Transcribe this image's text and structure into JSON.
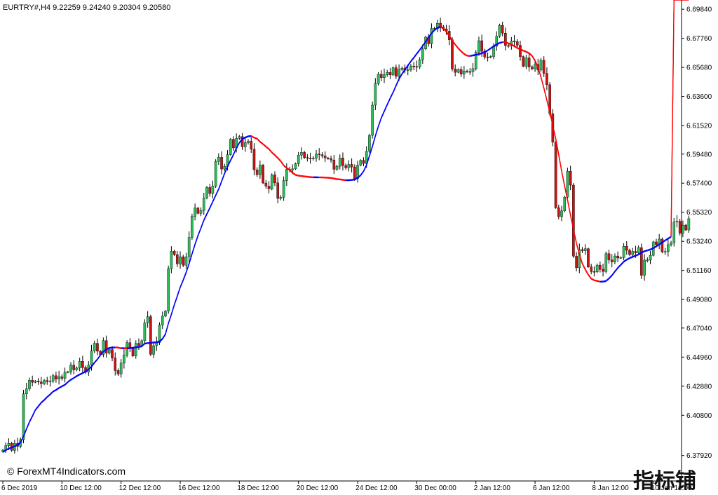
{
  "header": {
    "text": "EURTRY#,H4  9.22259 9.24240 9.20304 9.20580"
  },
  "watermark": {
    "text": "© ForexMT4Indicators.com"
  },
  "stamp": {
    "text": "指标铺"
  },
  "chart_data": {
    "type": "candlestick",
    "ylim": [
      6.361,
      6.705
    ],
    "y_ticks": [
      6.3792,
      6.408,
      6.4288,
      6.4496,
      6.4704,
      6.4908,
      6.5116,
      6.5324,
      6.5532,
      6.574,
      6.5948,
      6.6152,
      6.636,
      6.6568,
      6.6776,
      6.6984
    ],
    "x_ticks": [
      {
        "label": "6 Dec 2019",
        "index": 0
      },
      {
        "label": "10 Dec 12:00",
        "index": 20
      },
      {
        "label": "12 Dec 12:00",
        "index": 40
      },
      {
        "label": "16 Dec 12:00",
        "index": 60
      },
      {
        "label": "18 Dec 12:00",
        "index": 80
      },
      {
        "label": "20 Dec 12:00",
        "index": 100
      },
      {
        "label": "24 Dec 12:00",
        "index": 120
      },
      {
        "label": "30 Dec 00:00",
        "index": 140
      },
      {
        "label": "2 Jan 12:00",
        "index": 160
      },
      {
        "label": "6 Jan 12:00",
        "index": 180
      },
      {
        "label": "8 Jan 12:00",
        "index": 200
      },
      {
        "label": "10 Jan 12:00",
        "index": 220
      }
    ],
    "series": {
      "close": [
        6.3831,
        6.3863,
        6.3879,
        6.3829,
        6.3879,
        6.3858,
        6.3906,
        6.4233,
        6.4269,
        6.4331,
        6.4316,
        6.4324,
        6.4318,
        6.4306,
        6.4329,
        6.4321,
        6.4324,
        6.4363,
        6.4339,
        6.4355,
        6.4344,
        6.4388,
        6.439,
        6.4438,
        6.4405,
        6.4418,
        6.4466,
        6.4421,
        6.4388,
        6.4438,
        6.4541,
        6.4595,
        6.4538,
        6.4515,
        6.4614,
        6.4525,
        6.455,
        6.449,
        6.44,
        6.4375,
        6.4453,
        6.4511,
        6.4599,
        6.4562,
        6.4504,
        6.4594,
        6.458,
        6.4613,
        6.4741,
        6.4785,
        6.4516,
        6.4578,
        6.46,
        6.4726,
        6.4789,
        6.4825,
        6.5128,
        6.5253,
        6.5229,
        6.5163,
        6.5213,
        6.5153,
        6.5213,
        6.5352,
        6.5503,
        6.5562,
        6.5524,
        6.5545,
        6.5635,
        6.5709,
        6.5666,
        6.5719,
        6.5896,
        6.5925,
        6.5841,
        6.586,
        6.5944,
        6.6054,
        6.5992,
        6.606,
        6.6073,
        6.6,
        6.603,
        6.604,
        6.5983,
        6.5835,
        6.5801,
        6.5869,
        6.5741,
        6.5719,
        6.5699,
        6.5799,
        6.5742,
        6.5631,
        6.5639,
        6.5759,
        6.5839,
        6.5834,
        6.5842,
        6.5879,
        6.5941,
        6.596,
        6.5923,
        6.5918,
        6.5915,
        6.5919,
        6.5948,
        6.5943,
        6.5935,
        6.592,
        6.5915,
        6.5906,
        6.5839,
        6.5861,
        6.592,
        6.5866,
        6.585,
        6.5874,
        6.5856,
        6.5773,
        6.5868,
        6.5903,
        6.5881,
        6.5968,
        6.6082,
        6.6298,
        6.6452,
        6.6519,
        6.6495,
        6.6516,
        6.6532,
        6.6514,
        6.6566,
        6.6504,
        6.6553,
        6.6563,
        6.6548,
        6.655,
        6.6578,
        6.6574,
        6.6573,
        6.6623,
        6.67,
        6.6785,
        6.6737,
        6.6847,
        6.6843,
        6.6884,
        6.6856,
        6.6843,
        6.6827,
        6.6766,
        6.6557,
        6.6533,
        6.6553,
        6.652,
        6.6542,
        6.6538,
        6.6537,
        6.6559,
        6.6678,
        6.6759,
        6.6683,
        6.6642,
        6.664,
        6.6646,
        6.6719,
        6.679,
        6.6869,
        6.6813,
        6.6724,
        6.6721,
        6.6756,
        6.6752,
        6.6726,
        6.6645,
        6.6576,
        6.6636,
        6.6571,
        6.6558,
        6.659,
        6.6549,
        6.6619,
        6.6525,
        6.6444,
        6.6237,
        6.6033,
        6.5564,
        6.5501,
        6.5542,
        6.564,
        6.5825,
        6.5726,
        6.5218,
        6.5135,
        6.5265,
        6.5257,
        6.5271,
        6.5141,
        6.5108,
        6.5106,
        6.5154,
        6.5124,
        6.5108,
        6.5236,
        6.519,
        6.5177,
        6.5219,
        6.5205,
        6.5208,
        6.5289,
        6.526,
        6.5229,
        6.5252,
        6.5242,
        6.5279,
        6.5081,
        6.519,
        6.519,
        6.5224,
        6.532,
        6.5301,
        6.534,
        6.5249,
        6.5251,
        6.53,
        6.5313,
        6.5462,
        6.5467,
        6.5383,
        6.544,
        6.5405,
        6.5486
      ],
      "ma_lower": [
        6.3813,
        6.3828,
        6.3839,
        6.3847,
        6.3856,
        6.3866,
        6.3883,
        6.3926,
        6.3979,
        6.4028,
        6.407,
        6.4115,
        6.4141,
        6.4167,
        6.4186,
        6.4208,
        6.4226,
        6.4247,
        6.4258,
        6.4272,
        6.4284,
        6.4295,
        6.4315,
        6.4331,
        6.4344,
        6.4357,
        6.4369,
        6.4378,
        6.4391,
        6.4405,
        6.4424,
        6.4454,
        6.4478,
        6.4507,
        6.4533,
        6.4548,
        6.4559,
        6.456,
        6.4562,
        6.4561,
        6.4556,
        6.4557,
        6.4556,
        6.4557,
        6.4559,
        6.4563,
        6.4566,
        6.457,
        6.459,
        6.4593,
        6.4594,
        6.4598,
        6.4598,
        6.4605,
        6.4623,
        6.4657,
        6.4734,
        6.4798,
        6.4867,
        6.4928,
        6.4993,
        6.5043,
        6.5098,
        6.5161,
        6.5231,
        6.5299,
        6.5361,
        6.5416,
        6.5472,
        6.5516,
        6.5559,
        6.5605,
        6.5649,
        6.5695,
        6.575,
        6.5806,
        6.5856,
        6.5899,
        6.5941,
        6.5988,
        6.6026,
        6.6053,
        6.6064,
        6.6072,
        6.6075,
        6.6063,
        6.6056,
        6.6033,
        6.6017,
        6.5998,
        6.5981,
        6.5957,
        6.5938,
        6.5917,
        6.5894,
        6.5864,
        6.5846,
        6.5832,
        6.5811,
        6.5796,
        6.5791,
        6.5788,
        6.5785,
        6.5783,
        6.578,
        6.5779,
        6.5779,
        6.5779,
        6.5778,
        6.5777,
        6.5776,
        6.5774,
        6.577,
        6.5766,
        6.5764,
        6.5761,
        6.5758,
        6.5758,
        6.576,
        6.5763,
        6.5775,
        6.5793,
        6.5822,
        6.5867,
        6.5932,
        6.6,
        6.6075,
        6.6142,
        6.6204,
        6.6251,
        6.6298,
        6.6344,
        6.6387,
        6.6435,
        6.6482,
        6.6518,
        6.6549,
        6.6578,
        6.6608,
        6.6634,
        6.6663,
        6.669,
        6.6719,
        6.6749,
        6.6781,
        6.6809,
        6.6832,
        6.6848,
        6.6855,
        6.6844,
        6.6821,
        6.6789,
        6.6757,
        6.6729,
        6.6702,
        6.668,
        6.6661,
        6.6649,
        6.6647,
        6.6651,
        6.6655,
        6.666,
        6.6666,
        6.6675,
        6.6687,
        6.6701,
        6.6716,
        6.6729,
        6.674,
        6.6746,
        6.6745,
        6.6737,
        6.6729,
        6.6717,
        6.6704,
        6.6695,
        6.6685,
        6.6677,
        6.6666,
        6.6647,
        6.6614,
        6.6565,
        6.6496,
        6.6417,
        6.633,
        6.6247,
        6.615,
        6.6055,
        6.5942,
        6.5823,
        6.5717,
        6.5616,
        6.5508,
        6.5405,
        6.5308,
        6.5228,
        6.5162,
        6.5119,
        6.5083,
        6.5054,
        6.5043,
        6.5038,
        6.5033,
        6.5033,
        6.5037,
        6.5055,
        6.5077,
        6.5105,
        6.5131,
        6.5153,
        6.5175,
        6.519,
        6.5201,
        6.521,
        6.5218,
        6.5227,
        6.524,
        6.525,
        6.5256,
        6.5263,
        6.5272,
        6.5285,
        6.5299,
        6.5313,
        6.5327,
        6.5341,
        6.5353
      ],
      "ma_upper": [
        6.3819,
        6.3833,
        6.3844,
        6.3852,
        6.3861,
        6.3872,
        6.3889,
        6.3931,
        6.3985,
        6.4034,
        6.4076,
        6.412,
        6.4147,
        6.4173,
        6.4192,
        6.4213,
        6.4232,
        6.4252,
        6.4264,
        6.4278,
        6.429,
        6.4301,
        6.432,
        6.4337,
        6.4349,
        6.4363,
        6.4375,
        6.4384,
        6.4396,
        6.4411,
        6.443,
        6.4459,
        6.4483,
        6.4512,
        6.4538,
        6.4554,
        6.4565,
        6.4566,
        6.4568,
        6.4567,
        6.4562,
        6.4563,
        6.4562,
        6.4563,
        6.4565,
        6.4569,
        6.4572,
        6.4576,
        6.4596,
        6.4599,
        6.4599,
        6.4604,
        6.4604,
        6.4611,
        6.4629,
        6.4663,
        6.4739,
        6.4804,
        6.4873,
        6.4934,
        6.4998,
        6.5049,
        6.5104,
        6.5167,
        6.5237,
        6.5305,
        6.5367,
        6.5421,
        6.5478,
        6.5522,
        6.5565,
        6.561,
        6.5655,
        6.57,
        6.5756,
        6.5812,
        6.5862,
        6.5905,
        6.5947,
        6.5994,
        6.6032,
        6.6058,
        6.607,
        6.6078,
        6.608,
        6.6068,
        6.6061,
        6.6039,
        6.6022,
        6.6004,
        6.5987,
        6.5962,
        6.5944,
        6.5923,
        6.59,
        6.587,
        6.5851,
        6.5838,
        6.5817,
        6.5802,
        6.5797,
        6.5794,
        6.5791,
        6.5789,
        6.5786,
        6.5785,
        6.5785,
        6.5784,
        6.5784,
        6.5783,
        6.5782,
        6.578,
        6.5776,
        6.5771,
        6.577,
        6.5767,
        6.5764,
        6.5764,
        6.5766,
        6.5769,
        6.5781,
        6.5799,
        6.5827,
        6.5873,
        6.5938,
        6.6006,
        6.6081,
        6.6148,
        6.6209,
        6.6257,
        6.6304,
        6.635,
        6.6392,
        6.6441,
        6.6488,
        6.6524,
        6.6555,
        6.6584,
        6.6614,
        6.664,
        6.6669,
        6.6696,
        6.6724,
        6.6754,
        6.6787,
        6.6815,
        6.6838,
        6.6854,
        6.6861,
        6.685,
        6.6827,
        6.6795,
        6.6763,
        6.6734,
        6.6708,
        6.6686,
        6.6667,
        6.6655,
        6.6652,
        6.6657,
        6.6661,
        6.6666,
        6.6672,
        6.6681,
        6.6692,
        6.6707,
        6.6722,
        6.6735,
        6.6746,
        6.6751,
        6.6751,
        6.6743,
        6.6734,
        6.6723,
        6.671,
        6.6701,
        6.6691,
        6.6683,
        6.6672,
        6.6653,
        6.662,
        6.6571,
        6.6502,
        6.6423,
        6.6336,
        6.6253,
        6.6156,
        6.6061,
        6.5948,
        6.5829,
        6.5723,
        6.5622,
        6.5514,
        6.5411,
        6.5314,
        6.5234,
        6.5168,
        6.5125,
        6.5089,
        6.506,
        6.5048,
        6.5044,
        6.5038,
        6.5039,
        6.5043,
        6.5061,
        6.5083,
        6.5111,
        6.5137,
        6.5159,
        6.5181,
        6.5196,
        6.5207,
        6.5216,
        6.5224,
        6.5232,
        6.5246,
        6.5256,
        6.5262,
        6.5269,
        6.5278,
        6.5291,
        6.5305,
        6.5319,
        6.5333,
        6.5347,
        6.5359
      ],
      "ma_upper_color": [
        "#ff0000",
        "#0000ff"
      ]
    },
    "colors": {
      "bull": "#2bbd5a",
      "bear": "#c81414",
      "ma_up": "#0000ff",
      "ma_down": "#ff0000",
      "grid_axis": "#000000"
    }
  }
}
